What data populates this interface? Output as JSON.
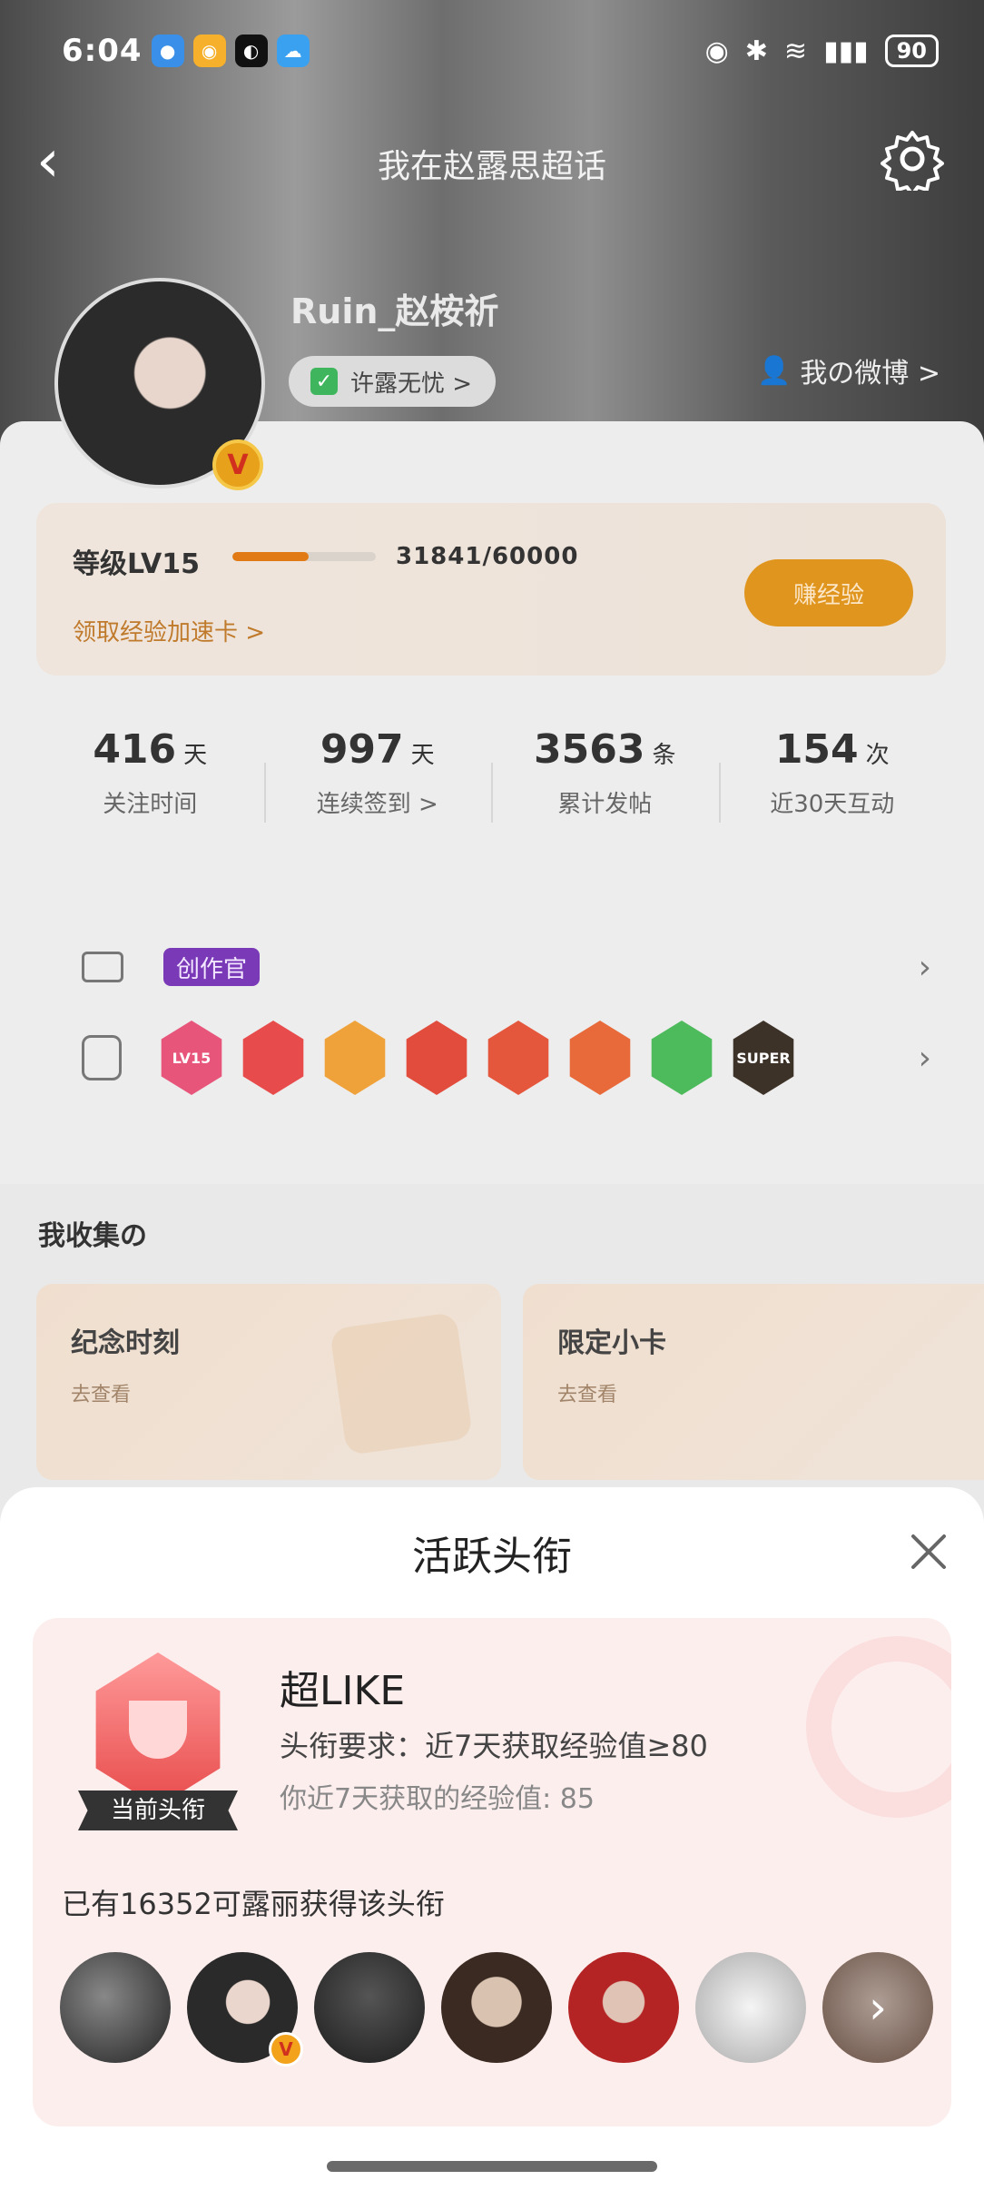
{
  "status_bar": {
    "time": "6:04",
    "battery": "90"
  },
  "nav": {
    "title": "我在赵露思超话"
  },
  "profile": {
    "username": "Ruin_赵桉祈",
    "title_chip": "许露无忧 >",
    "my_weibo": "我の微博 >",
    "v_badge": "V"
  },
  "level": {
    "label": "等级LV15",
    "progress": 0.53,
    "exp_text": "31841/60000",
    "link": "领取经验加速卡 >",
    "earn_button": "赚经验"
  },
  "stats": [
    {
      "num": "416",
      "unit": "天",
      "label": "关注时间"
    },
    {
      "num": "997",
      "unit": "天",
      "label": "连续签到 >"
    },
    {
      "num": "3563",
      "unit": "条",
      "label": "累计发帖"
    },
    {
      "num": "154",
      "unit": "次",
      "label": "近30天互动"
    }
  ],
  "badges": {
    "creator_tag": "创作官",
    "medals": [
      {
        "name": "LV15",
        "color": "#e8557b"
      },
      {
        "name": "",
        "color": "#e84b4b"
      },
      {
        "name": "",
        "color": "#f0a23a"
      },
      {
        "name": "",
        "color": "#e24c3c"
      },
      {
        "name": "",
        "color": "#e5573d"
      },
      {
        "name": "",
        "color": "#e86a3a"
      },
      {
        "name": "",
        "color": "#4dbb5b"
      },
      {
        "name": "SUPER",
        "color": "#3d3228"
      }
    ]
  },
  "collection": {
    "title": "我收集の",
    "cards": [
      {
        "title": "纪念时刻",
        "sub": "去查看"
      },
      {
        "title": "限定小卡",
        "sub": "去查看"
      }
    ]
  },
  "sheet": {
    "title": "活跃头衔",
    "current_label": "当前头衔",
    "name": "超LIKE",
    "requirement": "头衔要求：近7天获取经验值≥80",
    "mine": "你近7天获取的经验值: 85",
    "count": "已有16352可露丽获得该头衔"
  }
}
